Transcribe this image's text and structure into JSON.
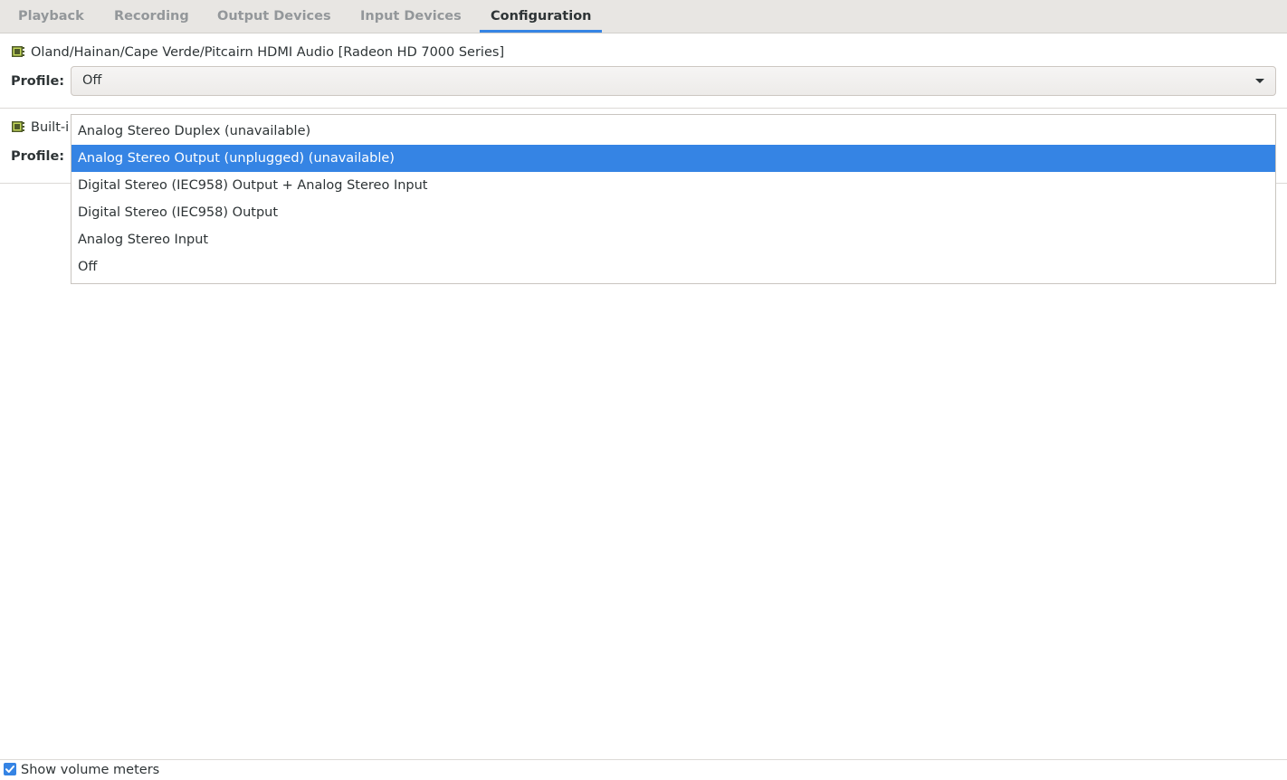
{
  "tabs": [
    {
      "label": "Playback",
      "active": false
    },
    {
      "label": "Recording",
      "active": false
    },
    {
      "label": "Output Devices",
      "active": false
    },
    {
      "label": "Input Devices",
      "active": false
    },
    {
      "label": "Configuration",
      "active": true
    }
  ],
  "devices": [
    {
      "name": "Oland/Hainan/Cape Verde/Pitcairn HDMI Audio [Radeon HD 7000 Series]",
      "icon": "sound-card-icon",
      "profile_label": "Profile:",
      "profile_value": "Off"
    },
    {
      "name": "Built-i",
      "icon": "sound-card-icon",
      "profile_label": "Profile:"
    }
  ],
  "profile_dropdown": {
    "options": [
      "Analog Stereo Duplex (unavailable)",
      "Analog Stereo Output (unplugged) (unavailable)",
      "Digital Stereo (IEC958) Output + Analog Stereo Input",
      "Digital Stereo (IEC958) Output",
      "Analog Stereo Input",
      "Off"
    ],
    "highlighted_index": 1
  },
  "footer": {
    "show_volume_meters_label": "Show volume meters",
    "show_volume_meters_checked": true
  },
  "colors": {
    "accent": "#3584e4",
    "tabbar_bg": "#e8e6e3",
    "text": "#2e3436",
    "inactive_tab_text": "#93979a"
  }
}
